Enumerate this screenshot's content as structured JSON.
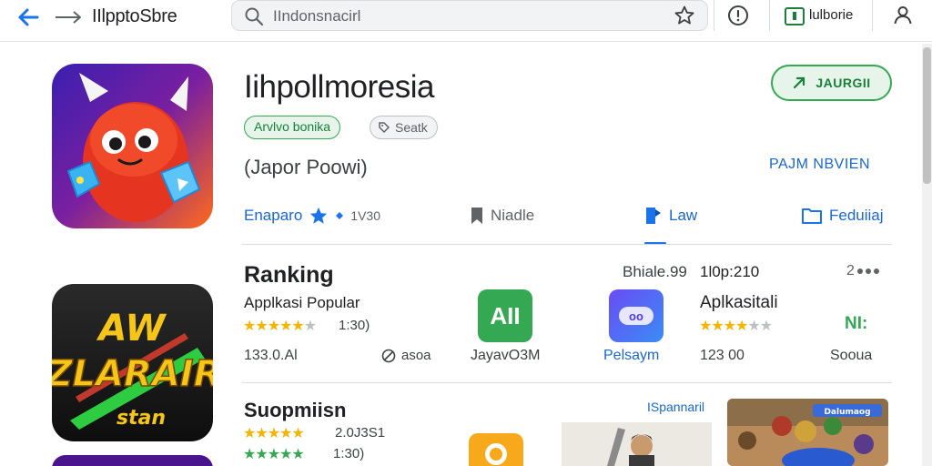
{
  "topbar": {
    "title": "IIlpptoSbre",
    "search_text": "IIndonsnacirl",
    "notice_label": "lulborie"
  },
  "app": {
    "name": "Iihpollmoresia",
    "badge_primary": "Arvlvo bonika",
    "badge_secondary": "Seatk",
    "developer": "(Japor Poowi)",
    "install_label": "JAURGII",
    "news_link": "PAJM NBVIEN"
  },
  "tabs": [
    {
      "label": "Enaparo",
      "count": "1V30"
    },
    {
      "label": "Niadle"
    },
    {
      "label": "Law"
    },
    {
      "label": "Feduiiaj"
    }
  ],
  "ranking": {
    "title": "Ranking",
    "meta_left": "Bhiale.99",
    "meta_right": "1l0p:210",
    "more_label": "2",
    "subtitle": "Applkasi Popular",
    "rating_count": "1:30)",
    "rating_value": 4.5,
    "size_text": "133.0.Al",
    "status_text": "asoa",
    "apps": [
      {
        "icon_text": "AII",
        "label": "JayavO3M",
        "color": "#34a853"
      },
      {
        "icon_text": "oo",
        "label": "Pelsaym",
        "color": "#4f6df5"
      }
    ],
    "side": {
      "title": "Aplkasitali",
      "rating_value": 3.5,
      "size": "123 00",
      "badge": "NI:",
      "footer": "Sooua"
    }
  },
  "section2": {
    "title": "Suopmiisn",
    "rating_1_count": "2.0J3S1",
    "rating_2_count": "1:30)",
    "link": "ISpannaril",
    "tile_label": "Dalumaog"
  },
  "colors": {
    "accent": "#1a73e8",
    "green": "#34a853",
    "star": "#f5b400",
    "star_green": "#34a853"
  }
}
